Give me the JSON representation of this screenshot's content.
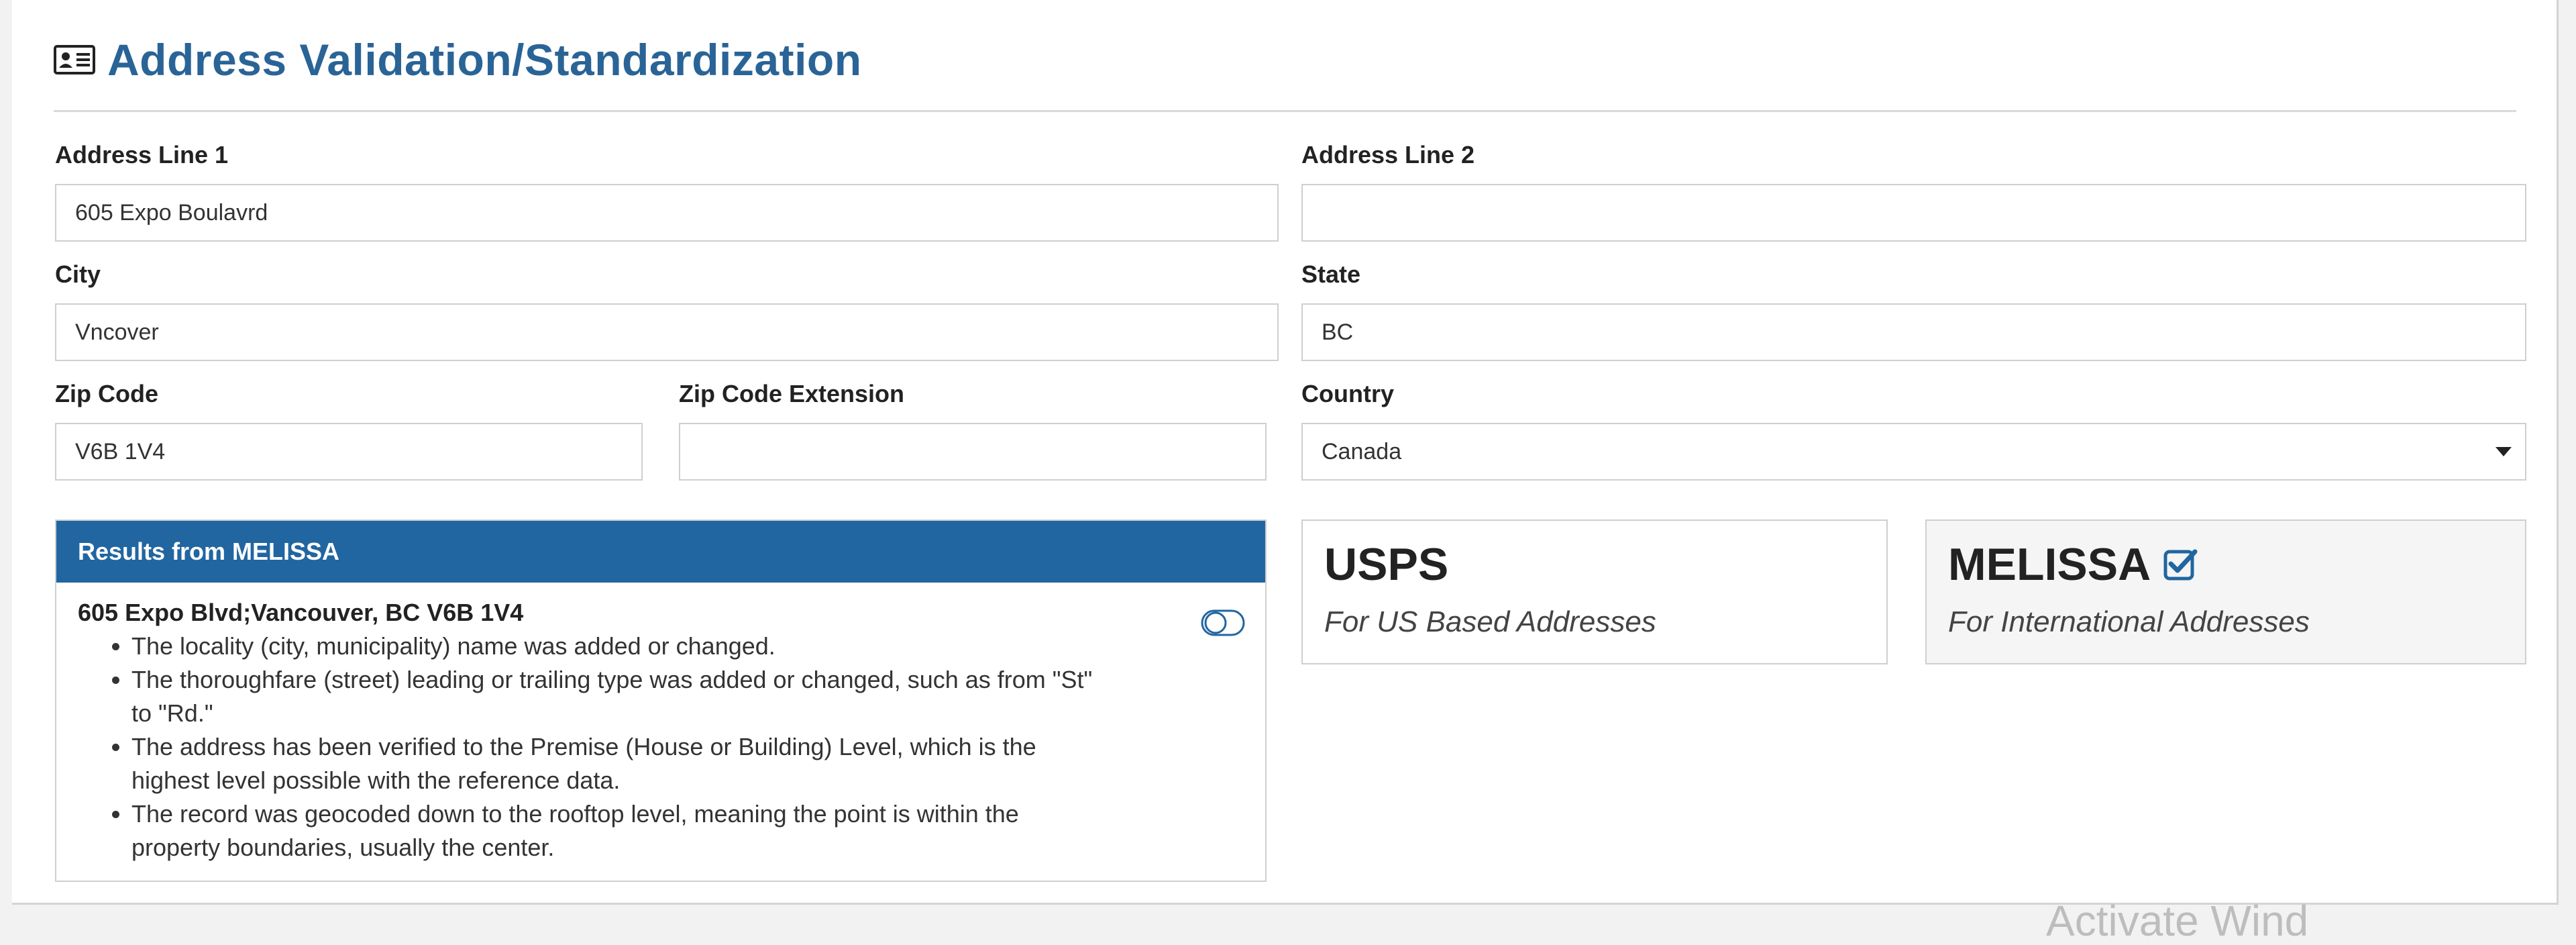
{
  "page": {
    "title": "Address Validation/Standardization",
    "title_icon": "address-card-icon"
  },
  "form": {
    "address_line_1": {
      "label": "Address Line 1",
      "value": "605 Expo Boulavrd"
    },
    "address_line_2": {
      "label": "Address Line 2",
      "value": ""
    },
    "city": {
      "label": "City",
      "value": "Vncover"
    },
    "state": {
      "label": "State",
      "value": "BC"
    },
    "zip_code": {
      "label": "Zip Code",
      "value": "V6B 1V4"
    },
    "zip_extension": {
      "label": "Zip Code Extension",
      "value": ""
    },
    "country": {
      "label": "Country",
      "value": "Canada"
    }
  },
  "results": {
    "header": "Results from MELISSA",
    "address": "605 Expo Blvd;Vancouver, BC V6B 1V4",
    "toggle_icon": "toggle-icon",
    "messages": [
      "The locality (city, municipality) name was added or changed.",
      "The thoroughfare (street) leading or trailing type was added or changed, such as from \"St\" to \"Rd.\"",
      "The address has been verified to the Premise (House or Building) Level, which is the highest level possible with the reference data.",
      "The record was geocoded down to the rooftop level, meaning the point is within the property boundaries, usually the center."
    ]
  },
  "providers": {
    "usps": {
      "name": "USPS",
      "description": "For US Based Addresses",
      "selected": false
    },
    "melissa": {
      "name": "MELISSA",
      "description": "For International Addresses",
      "selected": true,
      "check_icon": "checkbox-checked-icon"
    }
  },
  "watermark": "Activate Wind",
  "colors": {
    "accent": "#2166a0",
    "title": "#2a6496",
    "selected_card_bg": "#f5f5f5"
  }
}
